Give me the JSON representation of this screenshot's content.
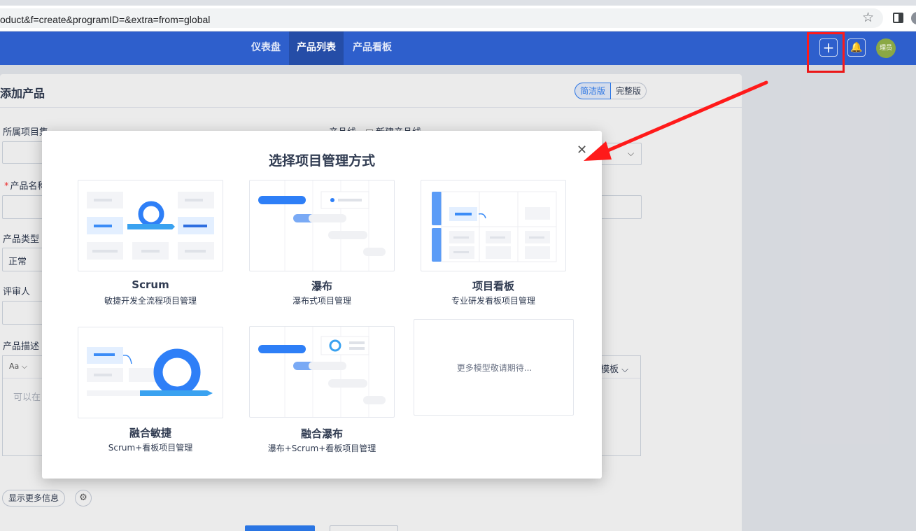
{
  "browser": {
    "url": "oduct&f=create&programID=&extra=from=global"
  },
  "header": {
    "nav": [
      "仪表盘",
      "产品列表",
      "产品看板"
    ],
    "avatar_text": "理员"
  },
  "page": {
    "title": "添加产品",
    "mode_simple": "简洁版",
    "mode_full": "完整版",
    "labels": {
      "project_set": "所属项目集",
      "product_line": "产品线",
      "new_product_line": "新建产品线",
      "product_name": "产品名称",
      "product_type": "产品类型",
      "reviewer": "评审人",
      "description": "产品描述"
    },
    "product_type_value": "正常",
    "editor_font_btn": "Aa",
    "editor_placeholder": "可以在",
    "template_btn": "模板",
    "more_info_btn": "显示更多信息"
  },
  "modal": {
    "title": "选择项目管理方式",
    "cards": [
      {
        "title": "Scrum",
        "desc": "敏捷开发全流程项目管理"
      },
      {
        "title": "瀑布",
        "desc": "瀑布式项目管理"
      },
      {
        "title": "项目看板",
        "desc": "专业研发看板项目管理"
      },
      {
        "title": "融合敏捷",
        "desc": "Scrum+看板项目管理"
      },
      {
        "title": "融合瀑布",
        "desc": "瀑布+Scrum+看板项目管理"
      }
    ],
    "more_text": "更多模型敬请期待..."
  },
  "colors": {
    "brand_blue": "#2e5fcc",
    "accent_blue": "#2e7ff7",
    "annotation_red": "#ff1a1a"
  }
}
